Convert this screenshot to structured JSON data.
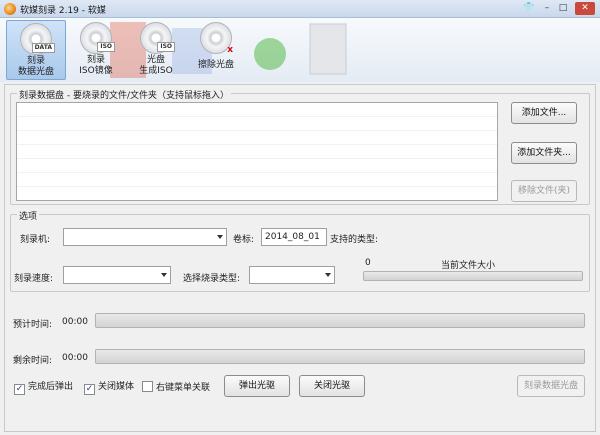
{
  "window": {
    "title": "软媒刻录 2.19 - 软媒"
  },
  "toolbar": {
    "tools": [
      {
        "label1": "刻录",
        "label2": "数据光盘",
        "badge": "DATA"
      },
      {
        "label1": "刻录",
        "label2": "ISO镜像",
        "badge": "ISO"
      },
      {
        "label1": "光盘",
        "label2": "生成ISO",
        "badge": "ISO"
      },
      {
        "label1": "擦除光盘",
        "label2": "",
        "badge": "x"
      }
    ]
  },
  "data_disc": {
    "group_title": "刻录数据盘 - 要烧录的文件/文件夹（支持鼠标拖入）",
    "add_file": "添加文件...",
    "add_folder": "添加文件夹...",
    "remove_file": "移除文件(夹)"
  },
  "options": {
    "group_title": "选项",
    "burner_label": "刻录机:",
    "volume_label": "卷标:",
    "volume_value": "2014_08_01",
    "supported_types_label": "支持的类型:",
    "speed_label": "刻录速度:",
    "burn_type_label": "选择烧录类型:",
    "size_value": "0",
    "size_label": "当前文件大小",
    "size_fill": 0
  },
  "progress": {
    "estimate_label": "预计时间:",
    "estimate_value": "00:00",
    "estimate_fill": 0,
    "remain_label": "剩余时间:",
    "remain_value": "00:00",
    "remain_fill": 0
  },
  "footer": {
    "eject_after": {
      "label": "完成后弹出",
      "checked": true
    },
    "close_media": {
      "label": "关闭媒体",
      "checked": true
    },
    "context_menu": {
      "label": "右键菜单关联",
      "checked": false
    },
    "eject_button": "弹出光驱",
    "close_drive_button": "关闭光驱",
    "burn_button": "刻录数据光盘"
  }
}
